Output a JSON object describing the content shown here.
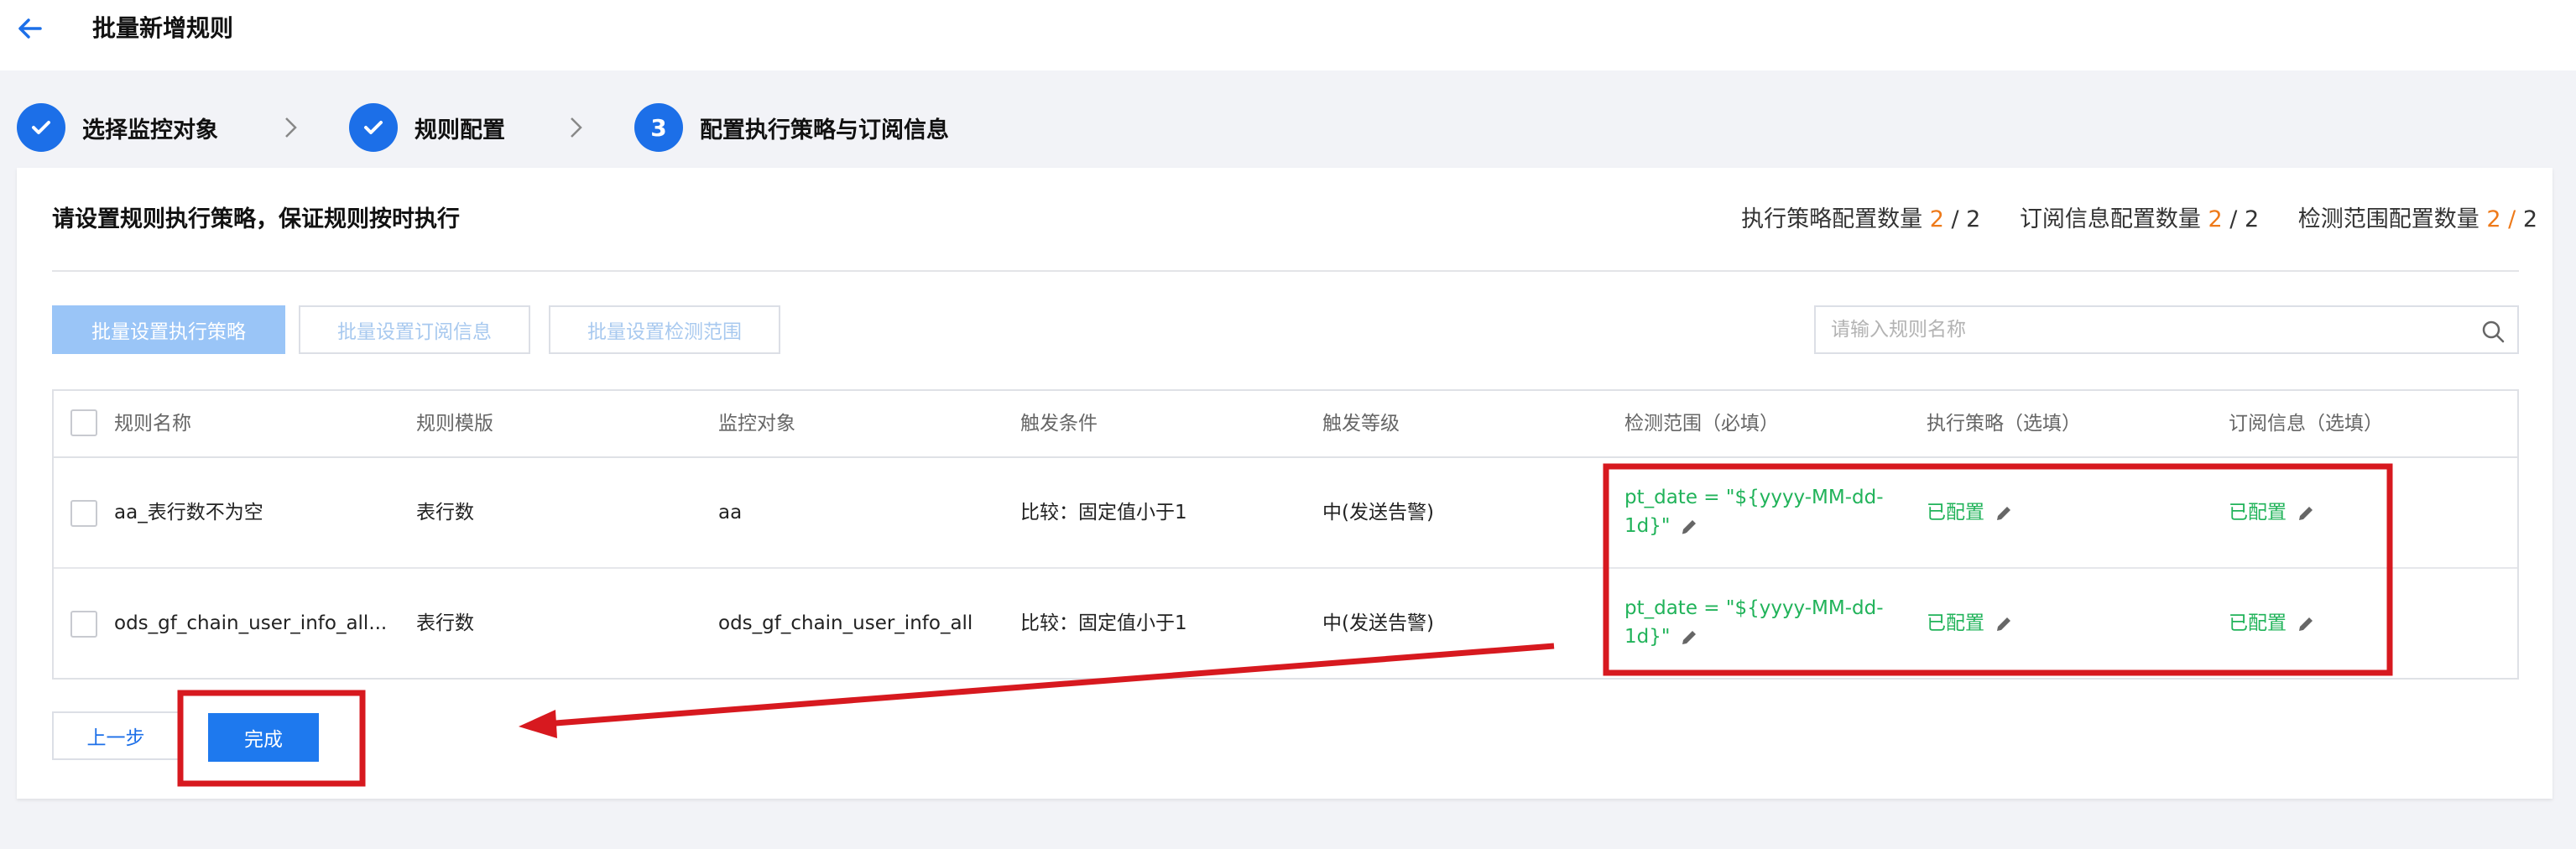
{
  "header": {
    "title": "批量新增规则",
    "back_icon": "arrow-left-icon"
  },
  "steps": [
    {
      "index": "1",
      "label": "选择监控对象",
      "status": "done",
      "icon": "check-icon"
    },
    {
      "index": "2",
      "label": "规则配置",
      "status": "done",
      "icon": "check-icon"
    },
    {
      "index": "3",
      "label": "配置执行策略与订阅信息",
      "status": "active"
    }
  ],
  "card": {
    "title": "请设置规则执行策略，保证规则按时执行",
    "counts": [
      {
        "label": "执行策略配置数量",
        "done": "2",
        "sep": " / ",
        "total": "2"
      },
      {
        "label": "订阅信息配置数量",
        "done": "2",
        "sep": " / ",
        "total": "2"
      },
      {
        "label": "检测范围配置数量",
        "done": "2",
        "sep": " / ",
        "total": "2"
      }
    ]
  },
  "toolbar": {
    "batch_strategy": "批量设置执行策略",
    "batch_subscribe": "批量设置订阅信息",
    "batch_range": "批量设置检测范围"
  },
  "search": {
    "placeholder": "请输入规则名称",
    "value": ""
  },
  "table": {
    "columns": [
      "规则名称",
      "规则模版",
      "监控对象",
      "触发条件",
      "触发等级",
      "检测范围（必填）",
      "执行策略（选填）",
      "订阅信息（选填）"
    ],
    "rows": [
      {
        "name": "aa_表行数不为空",
        "template": "表行数",
        "object": "aa",
        "condition": "比较：固定值小于1",
        "level": "中(发送告警)",
        "range_line1": "pt_date = \"${yyyy-MM-dd-",
        "range_line2": "1d}\"",
        "strategy": "已配置",
        "subscribe": "已配置"
      },
      {
        "name": "ods_gf_chain_user_info_all...",
        "template": "表行数",
        "object": "ods_gf_chain_user_info_all",
        "condition": "比较：固定值小于1",
        "level": "中(发送告警)",
        "range_line1": "pt_date = \"${yyyy-MM-dd-",
        "range_line2": "1d}\"",
        "strategy": "已配置",
        "subscribe": "已配置"
      }
    ]
  },
  "footer": {
    "prev": "上一步",
    "finish": "完成"
  },
  "colors": {
    "primary": "#1c6fe8",
    "accent_count": "#ee7a1a",
    "configured": "#21b35a",
    "annotation": "#d7191f"
  }
}
